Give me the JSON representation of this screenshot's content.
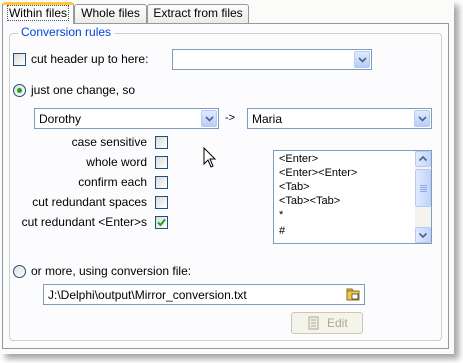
{
  "tabs": [
    {
      "label": "Within files",
      "active": true
    },
    {
      "label": "Whole files",
      "active": false
    },
    {
      "label": "Extract from files",
      "active": false
    }
  ],
  "group": {
    "title": "Conversion rules"
  },
  "cut_header": {
    "label": "cut header up to here:",
    "checked": false,
    "value": ""
  },
  "one_change": {
    "label": "just one change, so",
    "selected": true
  },
  "from_combo": {
    "value": "Dorothy"
  },
  "arrow_text": "->",
  "to_combo": {
    "value": "Maria"
  },
  "options": [
    {
      "label": "case sensitive",
      "checked": false
    },
    {
      "label": "whole word",
      "checked": false
    },
    {
      "label": "confirm each",
      "checked": false
    },
    {
      "label": "cut redundant spaces",
      "checked": false
    },
    {
      "label": "cut redundant <Enter>s",
      "checked": true
    }
  ],
  "special_list": [
    "<Enter>",
    "<Enter><Enter>",
    "<Tab>",
    "<Tab><Tab>",
    "*",
    "#"
  ],
  "or_more": {
    "label": "or more, using conversion file:",
    "selected": false
  },
  "conversion_file": {
    "value": "J:\\Delphi\\output\\Mirror_conversion.txt"
  },
  "edit_button": {
    "label": "Edit",
    "enabled": false
  },
  "colors": {
    "accent": "#0046d5",
    "check_green": "#21a121",
    "tab_highlight": "#ffc83c"
  }
}
